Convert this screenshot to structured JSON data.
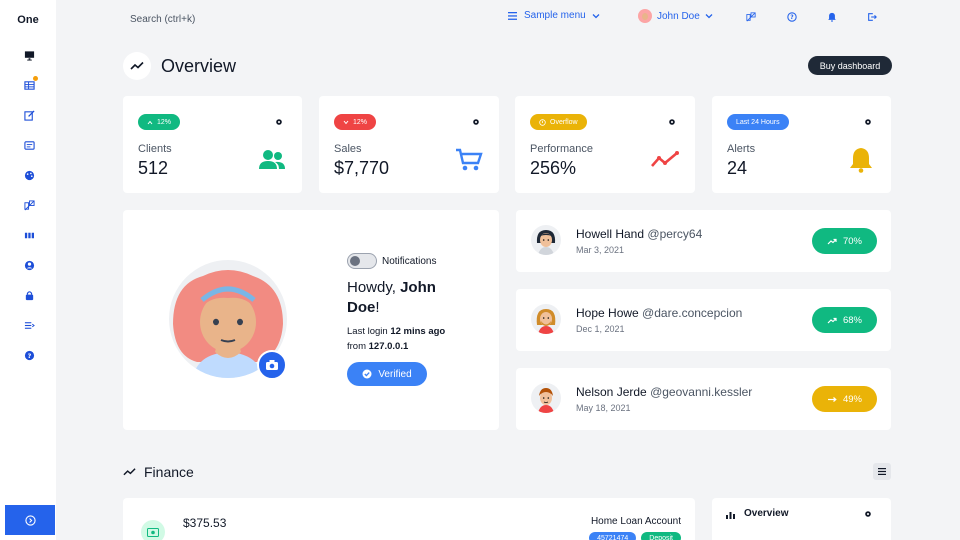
{
  "app": {
    "brand": "One"
  },
  "search": {
    "placeholder": "Search (ctrl+k)"
  },
  "topbar": {
    "menu_label": "Sample menu",
    "user_name": "John Doe"
  },
  "overview": {
    "title": "Overview",
    "buy_label": "Buy dashboard"
  },
  "stats": [
    {
      "badge": "12%",
      "badge_color": "#10b981",
      "label": "Clients",
      "value": "512",
      "icon": "users-icon",
      "icon_color": "#10b981"
    },
    {
      "badge": "12%",
      "badge_color": "#ef4444",
      "label": "Sales",
      "value": "$7,770",
      "icon": "cart-icon",
      "icon_color": "#3b82f6"
    },
    {
      "badge": "Overflow",
      "badge_color": "#eab308",
      "label": "Performance",
      "value": "256%",
      "icon": "trend-icon",
      "icon_color": "#ef4444"
    },
    {
      "badge": "Last 24 Hours",
      "badge_color": "#3b82f6",
      "label": "Alerts",
      "value": "24",
      "icon": "bell-icon",
      "icon_color": "#eab308"
    }
  ],
  "profile": {
    "notifications_label": "Notifications",
    "howdy_prefix": "Howdy, ",
    "name": "John Doe",
    "howdy_suffix": "!",
    "last_login_prefix": "Last login ",
    "last_login_value": "12 mins ago",
    "from_prefix": "from ",
    "ip": "127.0.0.1",
    "verified_label": "Verified"
  },
  "people": [
    {
      "name": "Howell Hand",
      "handle": "@percy64",
      "date": "Mar 3, 2021",
      "trend": "70%",
      "trend_color": "#10b981",
      "trend_icon": "trending-up-icon"
    },
    {
      "name": "Hope Howe",
      "handle": "@dare.concepcion",
      "date": "Dec 1, 2021",
      "trend": "68%",
      "trend_color": "#10b981",
      "trend_icon": "trending-up-icon"
    },
    {
      "name": "Nelson Jerde",
      "handle": "@geovanni.kessler",
      "date": "May 18, 2021",
      "trend": "49%",
      "trend_color": "#eab308",
      "trend_icon": "arrow-right-icon"
    }
  ],
  "finance": {
    "title": "Finance",
    "transaction": {
      "amount": "$375.53",
      "account": "Home Loan Account",
      "chip1": "45721474",
      "chip2": "Deposit"
    },
    "side_title": "Overview"
  }
}
